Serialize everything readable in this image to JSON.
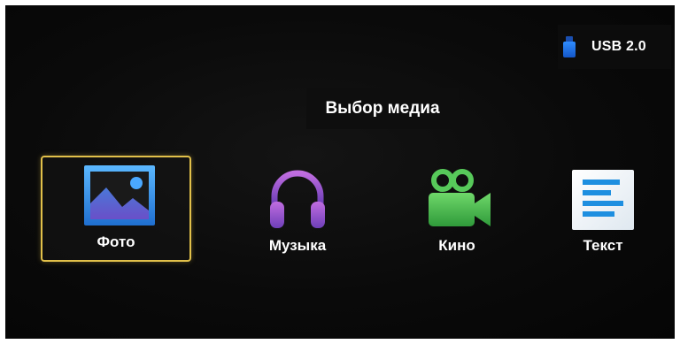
{
  "status": {
    "storage_label": "USB 2.0",
    "storage_icon": "usb-drive-icon"
  },
  "header": {
    "title": "Выбор медиа"
  },
  "media": {
    "selected_index": 0,
    "items": [
      {
        "label": "Фото",
        "icon": "photo-icon"
      },
      {
        "label": "Музыка",
        "icon": "headphones-icon"
      },
      {
        "label": "Кино",
        "icon": "video-camera-icon"
      },
      {
        "label": "Текст",
        "icon": "text-document-icon"
      }
    ]
  },
  "colors": {
    "selection_border": "#e1c04a",
    "photo": "#3a8fe0",
    "music": "#8e4fd0",
    "video": "#3fb54a",
    "text": "#1e8fe0"
  }
}
